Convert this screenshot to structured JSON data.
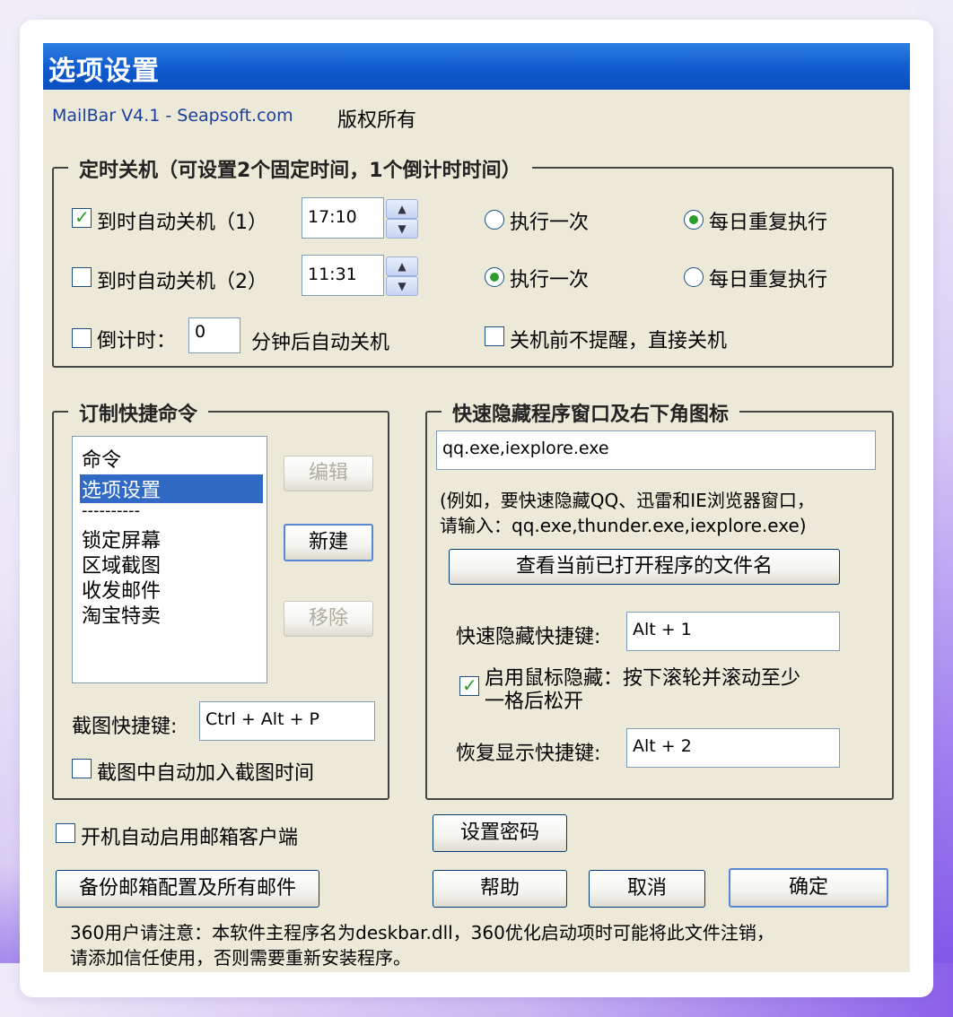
{
  "window": {
    "title": "选项设置"
  },
  "header": {
    "app_link": "MailBar V4.1 - Seapsoft.com",
    "copyright": "版权所有"
  },
  "shutdown": {
    "legend": "定时关机（可设置2个固定时间，1个倒计时时间）",
    "rule1": {
      "label": "到时自动关机（1）",
      "checked": true,
      "time": "17:10",
      "once": "执行一次",
      "daily": "每日重复执行",
      "selected": "daily"
    },
    "rule2": {
      "label": "到时自动关机（2）",
      "checked": false,
      "time": "11:31",
      "once": "执行一次",
      "daily": "每日重复执行",
      "selected": "once"
    },
    "countdown": {
      "label": "倒计时：",
      "value": "0",
      "suffix": "分钟后自动关机",
      "checked": false
    },
    "no_prompt": {
      "label": "关机前不提醒，直接关机",
      "checked": false
    }
  },
  "commands": {
    "legend": "订制快捷命令",
    "items": [
      "命令",
      "选项设置",
      "----------",
      "锁定屏幕",
      "区域截图",
      "收发邮件",
      "淘宝特卖"
    ],
    "selected_index": 1,
    "edit_button": "编辑",
    "new_button": "新建",
    "remove_button": "移除",
    "screenshot_hotkey_label": "截图快捷键:",
    "screenshot_hotkey_value": "Ctrl + Alt + P",
    "add_time_label": "截图中自动加入截图时间"
  },
  "hide": {
    "legend": "快速隐藏程序窗口及右下角图标",
    "programs_value": "qq.exe,iexplore.exe",
    "hint_line1": "(例如，要快速隐藏QQ、迅雷和IE浏览器窗口，",
    "hint_line2": "请输入：qq.exe,thunder.exe,iexplore.exe)",
    "view_button": "查看当前已打开程序的文件名",
    "hide_hotkey_label": "快速隐藏快捷键:",
    "hide_hotkey_value": "Alt + 1",
    "mouse_hide_line1": "启用鼠标隐藏：按下滚轮并滚动至少",
    "mouse_hide_line2": "一格后松开",
    "mouse_hide_checked": true,
    "restore_hotkey_label": "恢复显示快捷键:",
    "restore_hotkey_value": "Alt + 2"
  },
  "footer": {
    "autostart_label": "开机自动启用邮箱客户端",
    "set_password_button": "设置密码",
    "backup_button": "备份邮箱配置及所有邮件",
    "help_button": "帮助",
    "cancel_button": "取消",
    "ok_button": "确定",
    "notice_line1": "360用户请注意：本软件主程序名为deskbar.dll，360优化启动项时可能将此文件注销，",
    "notice_line2": "请添加信任使用，否则需要重新安装程序。"
  },
  "colors": {
    "titlebar": "#0f5bd0",
    "dialog_bg": "#ece9d8",
    "selection": "#316ac5",
    "link": "#1a3f9e"
  }
}
